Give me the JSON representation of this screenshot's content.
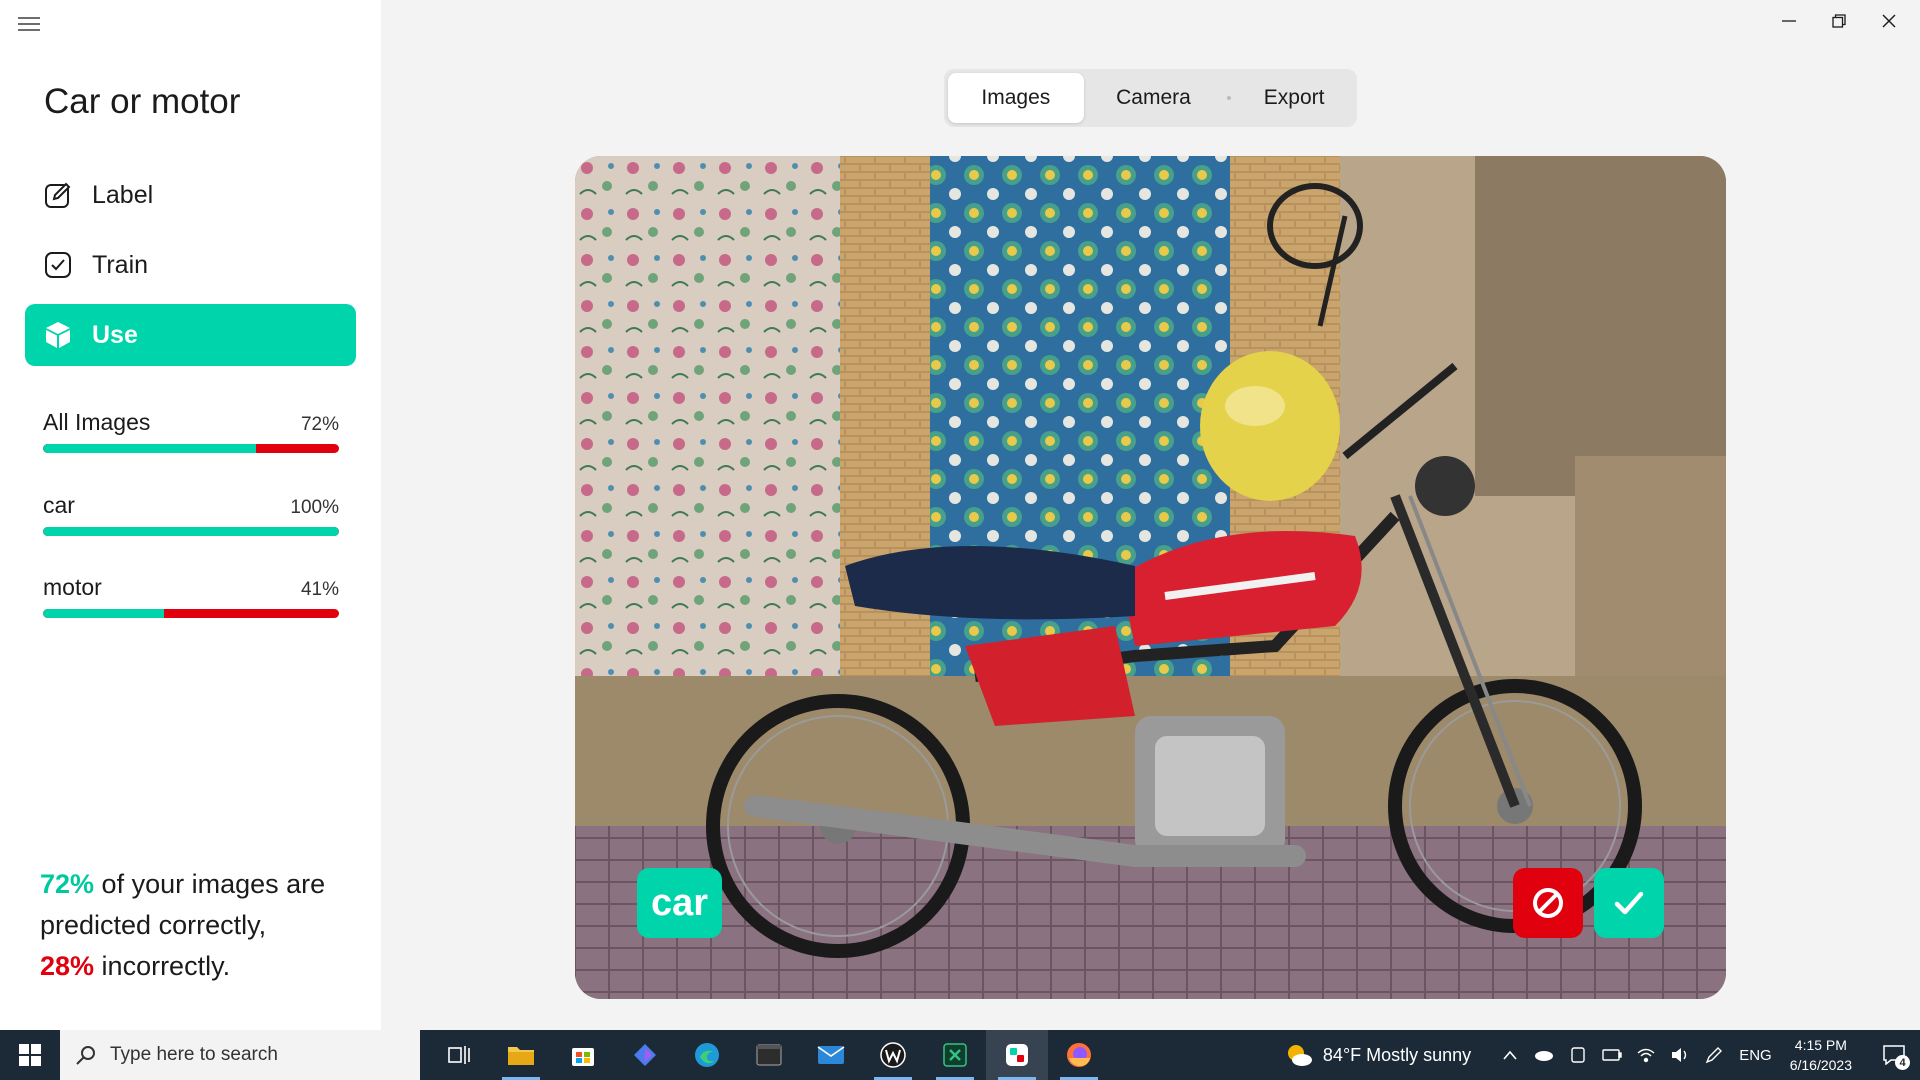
{
  "app": {
    "title": "Car or motor"
  },
  "nav": {
    "items": [
      {
        "label": "Label",
        "icon": "pencil-square-icon"
      },
      {
        "label": "Train",
        "icon": "checkbox-icon"
      },
      {
        "label": "Use",
        "icon": "cube-icon",
        "active": true
      }
    ]
  },
  "stats": [
    {
      "name": "All Images",
      "percent_text": "72%",
      "correct_fraction": 0.72
    },
    {
      "name": "car",
      "percent_text": "100%",
      "correct_fraction": 1.0
    },
    {
      "name": "motor",
      "percent_text": "41%",
      "correct_fraction": 0.41
    }
  ],
  "summary": {
    "correct_pct": "72%",
    "correct_text": " of your images are",
    "line2": "predicted correctly,",
    "incorrect_pct": "28%",
    "incorrect_text": " incorrectly."
  },
  "tabs": [
    {
      "label": "Images",
      "active": true
    },
    {
      "label": "Camera"
    },
    {
      "label": "Export"
    }
  ],
  "card": {
    "prediction_label": "car",
    "reject_icon": "no-entry-icon",
    "accept_icon": "check-icon"
  },
  "colors": {
    "accent": "#00d4aa",
    "error": "#e0000e",
    "taskbar": "#1c2a38"
  },
  "taskbar": {
    "search_placeholder": "Type here to search",
    "apps": [
      "task-view-icon",
      "file-explorer-icon",
      "store-icon",
      "copilot-icon",
      "edge-icon",
      "terminal-icon",
      "mail-icon",
      "w-app-icon",
      "excel-like-icon",
      "lobe-icon",
      "firefox-icon"
    ],
    "weather": "84°F  Mostly sunny",
    "language": "ENG",
    "time": "4:15 PM",
    "date": "6/16/2023",
    "notifications": "4"
  }
}
